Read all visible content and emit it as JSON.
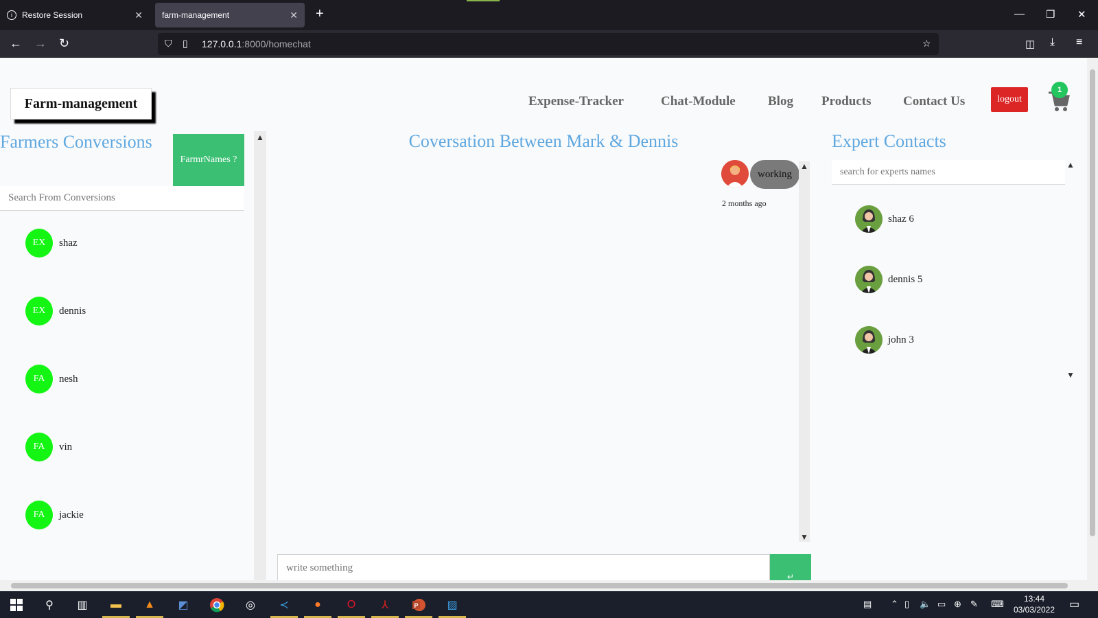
{
  "browser": {
    "tabs": [
      {
        "label": "Restore Session",
        "icon": "info-icon"
      },
      {
        "label": "farm-management",
        "icon": "none",
        "active": true
      }
    ],
    "url_host": "127.0.0.1",
    "url_path": ":8000/homechat"
  },
  "site": {
    "brand": "Farm-management",
    "menu": [
      "Expense-Tracker",
      "Chat-Module",
      "Blog",
      "Products",
      "Contact Us"
    ],
    "logout": "logout",
    "cart_count": "1"
  },
  "left": {
    "title": "Farmers Conversions",
    "farmr_button": "FarmrNames ?",
    "search_placeholder": "Search From Conversions",
    "conversations": [
      {
        "initials": "EX",
        "name": "shaz"
      },
      {
        "initials": "EX",
        "name": "dennis"
      },
      {
        "initials": "FA",
        "name": "nesh"
      },
      {
        "initials": "FA",
        "name": "vin"
      },
      {
        "initials": "FA",
        "name": "jackie"
      }
    ]
  },
  "chat": {
    "title": "Coversation Between Mark & Dennis",
    "message": "working",
    "message_time": "2 months ago",
    "input_placeholder": "write something"
  },
  "right": {
    "title": "Expert Contacts",
    "search_placeholder": "search for experts names",
    "experts": [
      {
        "name": "shaz 6"
      },
      {
        "name": "dennis 5"
      },
      {
        "name": "john 3"
      }
    ]
  },
  "taskbar": {
    "time": "13:44",
    "date": "03/03/2022"
  },
  "colors": {
    "accent_blue": "#5fa8e0",
    "green_button": "#3bbf73",
    "avatar_green": "#14f514",
    "logout_red": "#dc2626"
  }
}
